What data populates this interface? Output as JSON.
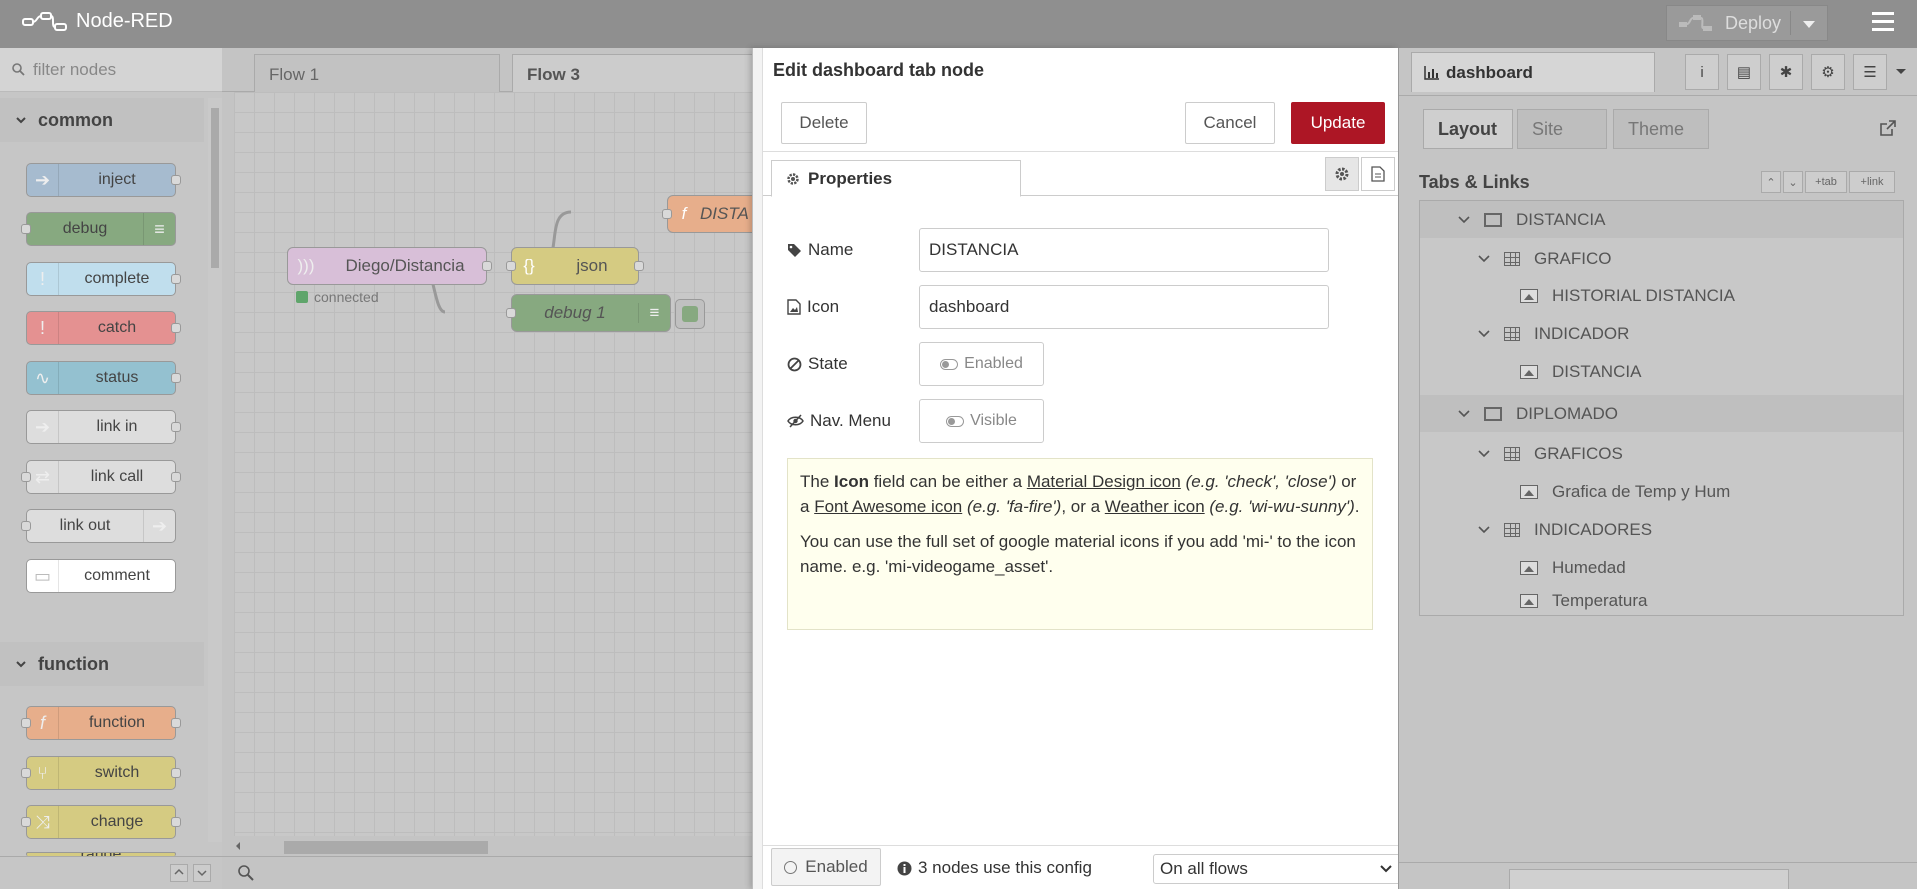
{
  "header": {
    "app_title": "Node-RED",
    "deploy_label": "Deploy"
  },
  "palette": {
    "filter_placeholder": "filter nodes",
    "categories": [
      {
        "label": "common",
        "nodes": [
          "inject",
          "debug",
          "complete",
          "catch",
          "status",
          "link in",
          "link call",
          "link out",
          "comment"
        ]
      },
      {
        "label": "function",
        "nodes": [
          "function",
          "switch",
          "change",
          "range"
        ]
      }
    ]
  },
  "workspace": {
    "tabs": [
      "Flow 1",
      "Flow 3"
    ],
    "nodes": {
      "mqtt": "Diego/Distancia",
      "mqtt_status": "connected",
      "json": "json",
      "debug": "debug 1",
      "function": "DISTA"
    }
  },
  "tray": {
    "title": "Edit dashboard tab node",
    "delete_label": "Delete",
    "cancel_label": "Cancel",
    "update_label": "Update",
    "properties_tab": "Properties",
    "fields": {
      "name_label": "Name",
      "name_value": "DISTANCIA",
      "icon_label": "Icon",
      "icon_value": "dashboard",
      "state_label": "State",
      "state_value": "Enabled",
      "nav_label": "Nav. Menu",
      "nav_value": "Visible"
    },
    "help": {
      "p1_a": "The ",
      "p1_icon": "Icon",
      "p1_b": " field can be either a ",
      "p1_md": "Material Design icon",
      "p1_md_eg": "(e.g. 'check', 'close')",
      "p1_c": " or a ",
      "p1_fa": "Font Awesome icon",
      "p1_fa_eg": "(e.g. 'fa-fire')",
      "p1_d": ", or a ",
      "p1_wi": "Weather icon",
      "p1_wi_eg": "(e.g. 'wi-wu-sunny')",
      "p1_e": ".",
      "p2": "You can use the full set of google material icons if you add 'mi-' to the icon name. e.g. 'mi-videogame_asset'."
    },
    "footer": {
      "enabled_label": "Enabled",
      "nodes_use": "3 nodes use this config",
      "scope_value": "On all flows"
    }
  },
  "sidebar": {
    "tab_label": "dashboard",
    "subtabs": [
      "Layout",
      "Site",
      "Theme"
    ],
    "section_title": "Tabs & Links",
    "buttons": {
      "tab": "tab",
      "link": "link"
    },
    "tree": [
      {
        "level": 0,
        "type": "tab",
        "label": "DISTANCIA"
      },
      {
        "level": 1,
        "type": "group",
        "label": "GRAFICO"
      },
      {
        "level": 2,
        "type": "widget",
        "label": "HISTORIAL DISTANCIA"
      },
      {
        "level": 1,
        "type": "group",
        "label": "INDICADOR"
      },
      {
        "level": 2,
        "type": "widget",
        "label": "DISTANCIA"
      },
      {
        "level": 0,
        "type": "tab",
        "label": "DIPLOMADO"
      },
      {
        "level": 1,
        "type": "group",
        "label": "GRAFICOS"
      },
      {
        "level": 2,
        "type": "widget",
        "label": "Grafica de Temp y Hum"
      },
      {
        "level": 1,
        "type": "group",
        "label": "INDICADORES"
      },
      {
        "level": 2,
        "type": "widget",
        "label": "Humedad"
      },
      {
        "level": 2,
        "type": "widget",
        "label": "Temperatura"
      }
    ]
  },
  "colors": {
    "header": "#8f8f8f",
    "update": "#ad1625",
    "help_bg": "#ffffee"
  }
}
